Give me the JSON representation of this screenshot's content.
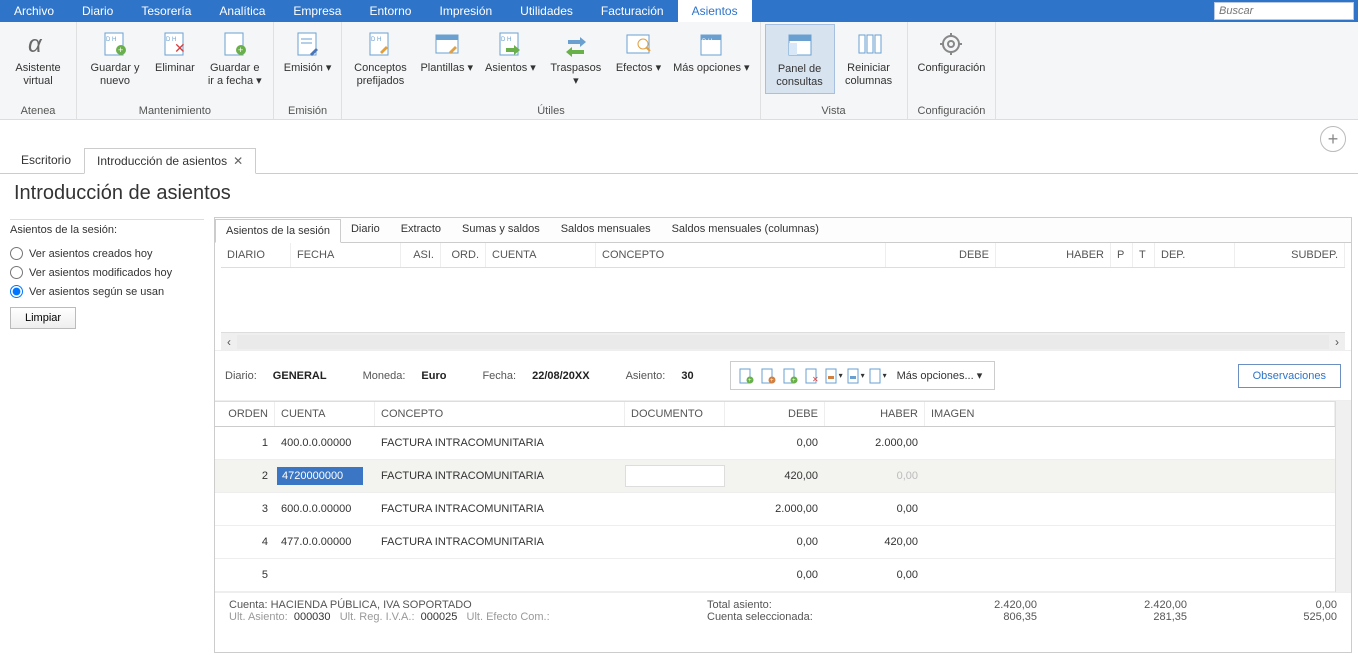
{
  "menu": [
    "Archivo",
    "Diario",
    "Tesorería",
    "Analítica",
    "Empresa",
    "Entorno",
    "Impresión",
    "Utilidades",
    "Facturación",
    "Asientos"
  ],
  "menu_active": 9,
  "search_placeholder": "Buscar",
  "ribbon": {
    "groups": [
      {
        "label": "Atenea",
        "buttons": [
          {
            "label": "Asistente virtual",
            "icon": "alpha"
          }
        ]
      },
      {
        "label": "Mantenimiento",
        "buttons": [
          {
            "label": "Guardar y nuevo",
            "icon": "doc-plus"
          },
          {
            "label": "Eliminar",
            "icon": "doc-x"
          },
          {
            "label": "Guardar e ir a fecha ▾",
            "icon": "doc-plus"
          }
        ]
      },
      {
        "label": "Emisión",
        "buttons": [
          {
            "label": "Emisión ▾",
            "icon": "doc-pen"
          }
        ]
      },
      {
        "label": "Útiles",
        "buttons": [
          {
            "label": "Conceptos prefijados",
            "icon": "doc-edit"
          },
          {
            "label": "Plantillas ▾",
            "icon": "tmpl"
          },
          {
            "label": "Asientos ▾",
            "icon": "doc-arrow"
          },
          {
            "label": "Traspasos ▾",
            "icon": "transfer"
          },
          {
            "label": "Efectos ▾",
            "icon": "fx"
          },
          {
            "label": "Más opciones ▾",
            "icon": "cal"
          }
        ]
      },
      {
        "label": "Vista",
        "buttons": [
          {
            "label": "Panel de consultas",
            "icon": "panel",
            "active": true
          },
          {
            "label": "Reiniciar columnas",
            "icon": "cols"
          }
        ]
      },
      {
        "label": "Configuración",
        "buttons": [
          {
            "label": "Configuración",
            "icon": "gear"
          }
        ]
      }
    ]
  },
  "doc_tabs": [
    {
      "label": "Escritorio"
    },
    {
      "label": "Introducción de asientos",
      "active": true,
      "close": true
    }
  ],
  "page_title": "Introducción de asientos",
  "sidebar": {
    "title": "Asientos de la sesión:",
    "radios": [
      {
        "label": "Ver asientos creados hoy",
        "checked": false
      },
      {
        "label": "Ver asientos modificados hoy",
        "checked": false
      },
      {
        "label": "Ver asientos según se usan",
        "checked": true
      }
    ],
    "clear_btn": "Limpiar"
  },
  "sub_tabs": [
    "Asientos de la sesión",
    "Diario",
    "Extracto",
    "Sumas y saldos",
    "Saldos mensuales",
    "Saldos mensuales (columnas)"
  ],
  "sub_tab_active": 0,
  "upper_grid_headers": [
    "DIARIO",
    "FECHA",
    "ASI.",
    "ORD.",
    "CUENTA",
    "CONCEPTO",
    "DEBE",
    "HABER",
    "P",
    "T",
    "DEP.",
    "SUBDEP."
  ],
  "info": {
    "diario_label": "Diario:",
    "diario_value": "GENERAL",
    "moneda_label": "Moneda:",
    "moneda_value": "Euro",
    "fecha_label": "Fecha:",
    "fecha_value": "22/08/20XX",
    "asiento_label": "Asiento:",
    "asiento_value": "30",
    "more": "Más opciones... ▾",
    "obs": "Observaciones"
  },
  "lower_grid_headers": [
    "ORDEN",
    "CUENTA",
    "CONCEPTO",
    "DOCUMENTO",
    "DEBE",
    "HABER",
    "IMAGEN"
  ],
  "rows": [
    {
      "orden": "1",
      "cuenta": "400.0.0.00000",
      "concepto": "FACTURA INTRACOMUNITARIA",
      "doc": "",
      "debe": "0,00",
      "haber": "2.000,00"
    },
    {
      "orden": "2",
      "cuenta": "4720000000",
      "concepto": "FACTURA INTRACOMUNITARIA",
      "doc": "",
      "debe": "420,00",
      "haber": "0,00",
      "sel": true,
      "edit": true,
      "haber_dim": true
    },
    {
      "orden": "3",
      "cuenta": "600.0.0.00000",
      "concepto": "FACTURA INTRACOMUNITARIA",
      "doc": "",
      "debe": "2.000,00",
      "haber": "0,00"
    },
    {
      "orden": "4",
      "cuenta": "477.0.0.00000",
      "concepto": "FACTURA INTRACOMUNITARIA",
      "doc": "",
      "debe": "0,00",
      "haber": "420,00"
    },
    {
      "orden": "5",
      "cuenta": "",
      "concepto": "",
      "doc": "",
      "debe": "0,00",
      "haber": "0,00"
    }
  ],
  "footer": {
    "cuenta_label": "Cuenta:",
    "cuenta_value": "HACIENDA PÚBLICA, IVA SOPORTADO",
    "ult_asiento_label": "Ult. Asiento:",
    "ult_asiento_value": "000030",
    "ult_reg_label": "Ult. Reg. I.V.A.:",
    "ult_reg_value": "000025",
    "ult_efecto_label": "Ult. Efecto Com.:",
    "total_label": "Total asiento:",
    "sel_label": "Cuenta seleccionada:",
    "totals": [
      "2.420,00",
      "2.420,00",
      "0,00"
    ],
    "sel_totals": [
      "806,35",
      "281,35",
      "525,00"
    ]
  }
}
